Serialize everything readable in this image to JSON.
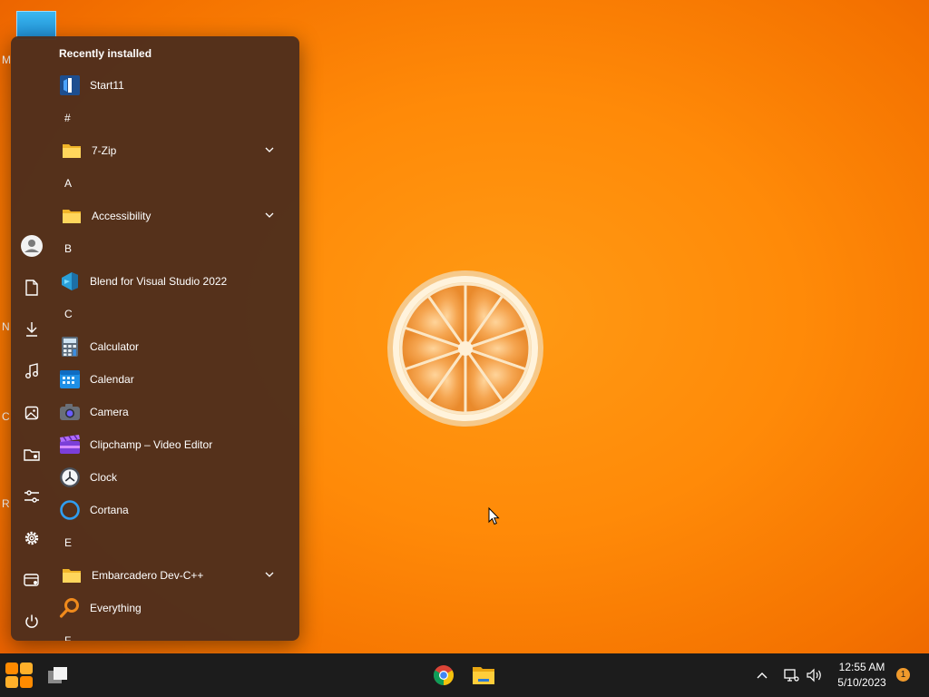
{
  "desktop": {
    "edge_letters": [
      "M",
      "N",
      "C",
      "R"
    ]
  },
  "start_menu": {
    "section_title": "Recently installed",
    "recent": [
      {
        "label": "Start11",
        "icon": "start11-icon"
      }
    ],
    "groups": [
      {
        "letter": "#",
        "items": [
          {
            "label": "7-Zip",
            "icon": "folder-icon",
            "folder": true
          }
        ]
      },
      {
        "letter": "A",
        "items": [
          {
            "label": "Accessibility",
            "icon": "folder-icon",
            "folder": true
          }
        ]
      },
      {
        "letter": "B",
        "items": [
          {
            "label": "Blend for Visual Studio 2022",
            "icon": "blend-icon"
          }
        ]
      },
      {
        "letter": "C",
        "items": [
          {
            "label": "Calculator",
            "icon": "calculator-icon"
          },
          {
            "label": "Calendar",
            "icon": "calendar-icon"
          },
          {
            "label": "Camera",
            "icon": "camera-icon"
          },
          {
            "label": "Clipchamp – Video Editor",
            "icon": "clipchamp-icon"
          },
          {
            "label": "Clock",
            "icon": "clock-icon"
          },
          {
            "label": "Cortana",
            "icon": "cortana-icon"
          }
        ]
      },
      {
        "letter": "E",
        "items": [
          {
            "label": "Embarcadero Dev-C++",
            "icon": "folder-icon",
            "folder": true
          },
          {
            "label": "Everything",
            "icon": "everything-icon"
          }
        ]
      },
      {
        "letter": "F",
        "items": []
      }
    ],
    "rail_icons": [
      "user-avatar-icon",
      "documents-icon",
      "downloads-icon",
      "music-icon",
      "pictures-icon",
      "network-folder-icon",
      "settings-sliders-icon",
      "settings-gear-icon",
      "file-explorer-icon",
      "power-icon"
    ]
  },
  "taskbar": {
    "time": "12:55 AM",
    "date": "5/10/2023",
    "notification_count": "1",
    "pinned": [
      "start-button",
      "task-view-button",
      "chrome-button",
      "file-explorer-button"
    ]
  },
  "colors": {
    "menu_bg": "#4e2e1c",
    "taskbar_bg": "#1c1c1c",
    "wallpaper": "#ff8a08",
    "badge": "#f09a2c"
  }
}
